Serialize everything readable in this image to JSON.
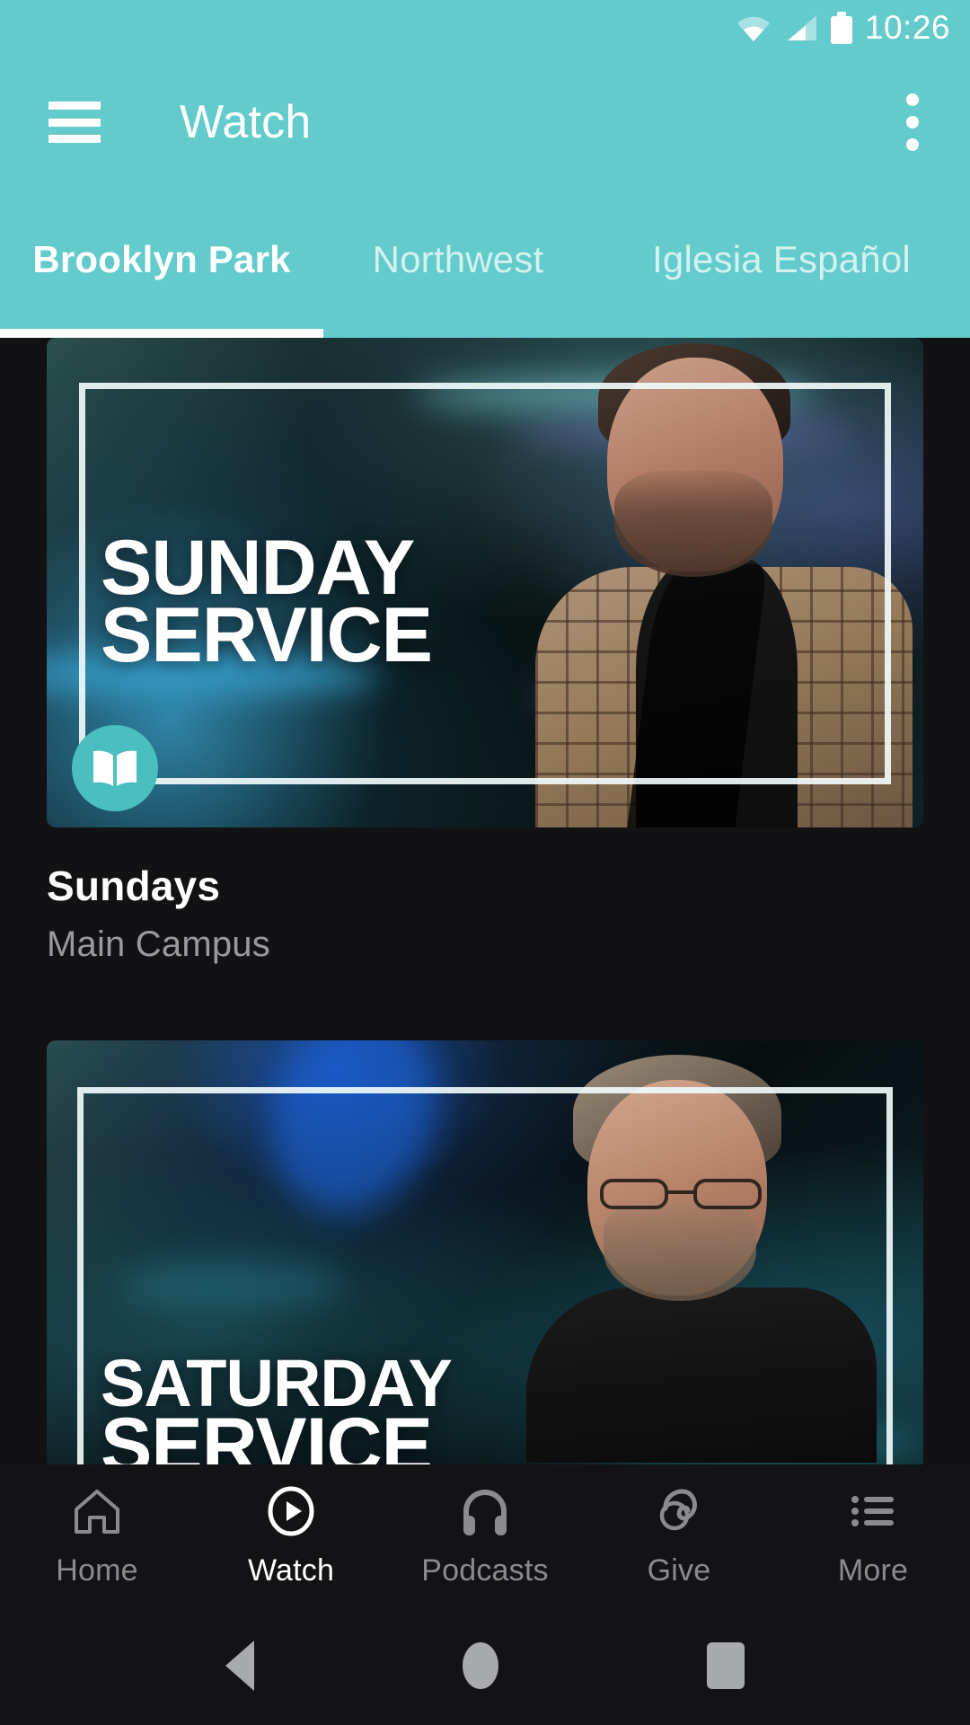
{
  "status_bar": {
    "time": "10:26",
    "wifi_icon": "wifi-icon",
    "signal_icon": "cellular-signal-icon",
    "battery_icon": "battery-full-icon"
  },
  "app_bar": {
    "menu_icon": "hamburger-menu-icon",
    "title": "Watch",
    "overflow_icon": "more-vertical-icon"
  },
  "tabs": {
    "items": [
      {
        "label": "Brooklyn Park",
        "active": true
      },
      {
        "label": "Northwest",
        "active": false
      },
      {
        "label": "Iglesia Español",
        "active": false
      }
    ]
  },
  "colors": {
    "accent_teal": "#63CBCB",
    "badge_teal": "#4BBFBF",
    "background": "#121214",
    "nav_background": "#131315",
    "text_primary": "#FFFFFF",
    "text_secondary": "#9A9A9D",
    "nav_inactive": "#8B8B8E",
    "system_nav_icon": "#A8AAAD"
  },
  "cards": [
    {
      "overlay_line1": "SUNDAY",
      "overlay_line2": "SERVICE",
      "badge_icon": "book-icon",
      "title": "Sundays",
      "subtitle": "Main Campus"
    },
    {
      "overlay_line1": "SATURDAY",
      "overlay_line2": "SERVICE",
      "badge_icon": "",
      "title": "",
      "subtitle": ""
    }
  ],
  "bottom_nav": {
    "items": [
      {
        "label": "Home",
        "icon": "home-icon",
        "active": false
      },
      {
        "label": "Watch",
        "icon": "play-circle-icon",
        "active": true
      },
      {
        "label": "Podcasts",
        "icon": "headphones-icon",
        "active": false
      },
      {
        "label": "Give",
        "icon": "giving-hand-icon",
        "active": false
      },
      {
        "label": "More",
        "icon": "list-menu-icon",
        "active": false
      }
    ]
  },
  "system_nav": {
    "back_icon": "back-triangle-icon",
    "home_icon": "home-circle-icon",
    "recents_icon": "recents-square-icon"
  }
}
